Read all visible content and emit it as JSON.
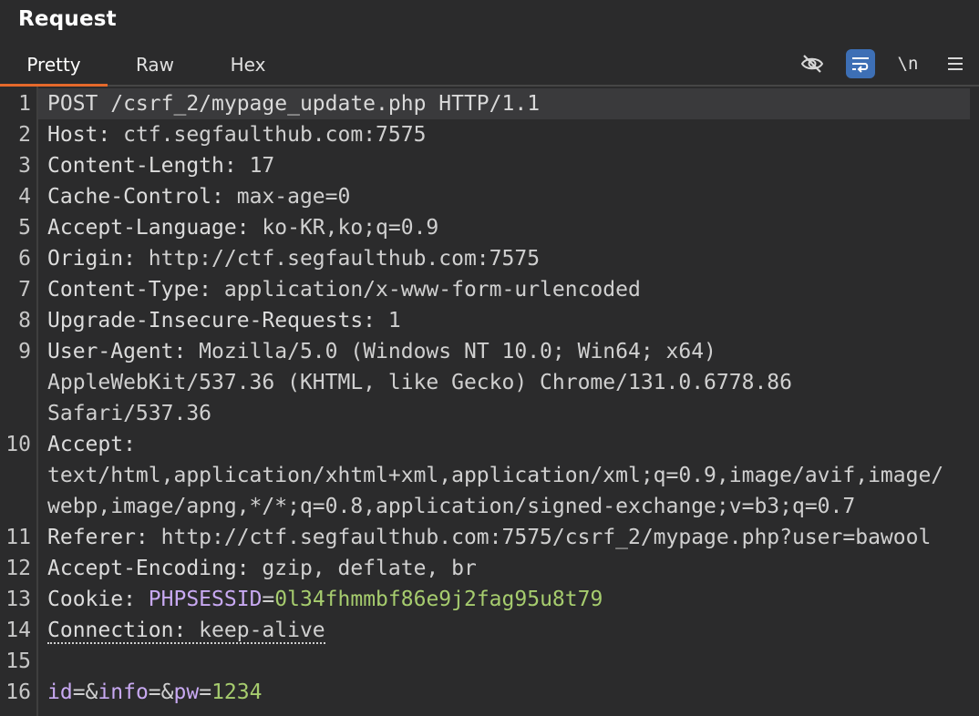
{
  "header": {
    "title": "Request"
  },
  "tabs": {
    "pretty": "Pretty",
    "raw": "Raw",
    "hex": "Hex"
  },
  "toolbar": {
    "eye_icon": "eye-slash-icon",
    "wrap_icon": "text-wrap-icon",
    "newline_label": "\\n",
    "menu_icon": "hamburger-menu-icon"
  },
  "colors": {
    "accent": "#e5692b",
    "wrap_button": "#3d6fb5",
    "param_name": "#c8a9f2",
    "param_value": "#a6cc6e"
  },
  "request": {
    "line_numbers": [
      "1",
      "2",
      "3",
      "4",
      "5",
      "6",
      "7",
      "8",
      "9",
      "10",
      "11",
      "12",
      "13",
      "14",
      "15",
      "16"
    ],
    "l1": "POST /csrf_2/mypage_update.php HTTP/1.1",
    "l2_key": "Host:",
    "l2_val": " ctf.segfaulthub.com:7575",
    "l3_key": "Content-Length:",
    "l3_val": " 17",
    "l4_key": "Cache-Control:",
    "l4_val": " max-age=0",
    "l5_key": "Accept-Language:",
    "l5_val": " ko-KR,ko;q=0.9",
    "l6_key": "Origin:",
    "l6_val": " http://ctf.segfaulthub.com:7575",
    "l7_key": "Content-Type:",
    "l7_val": " application/x-www-form-urlencoded",
    "l8_key": "Upgrade-Insecure-Requests:",
    "l8_val": " 1",
    "l9_key": "User-Agent:",
    "l9_val": " Mozilla/5.0 (Windows NT 10.0; Win64; x64)",
    "l9_wrap1": "AppleWebKit/537.36 (KHTML, like Gecko) Chrome/131.0.6778.86",
    "l9_wrap2": "Safari/537.36",
    "l10_key": "Accept:",
    "l10_wrap1": "text/html,application/xhtml+xml,application/xml;q=0.9,image/avif,image/",
    "l10_wrap2": "webp,image/apng,*/*;q=0.8,application/signed-exchange;v=b3;q=0.7",
    "l11_key": "Referer:",
    "l11_val": " http://ctf.segfaulthub.com:7575/csrf_2/mypage.php?user=bawool",
    "l12_key": "Accept-Encoding:",
    "l12_val": " gzip, deflate, br",
    "l13_key": "Cookie:",
    "l13_cookie_name": "PHPSESSID",
    "l13_eq": "=",
    "l13_cookie_val": "0l34fhmmbf86e9j2fag95u8t79",
    "l14_key": "Connection:",
    "l14_val": " keep-alive",
    "l16_p1": "id",
    "l16_s1": "=&",
    "l16_p2": "info",
    "l16_s2": "=&",
    "l16_p3": "pw",
    "l16_s3": "=",
    "l16_v3": "1234"
  }
}
